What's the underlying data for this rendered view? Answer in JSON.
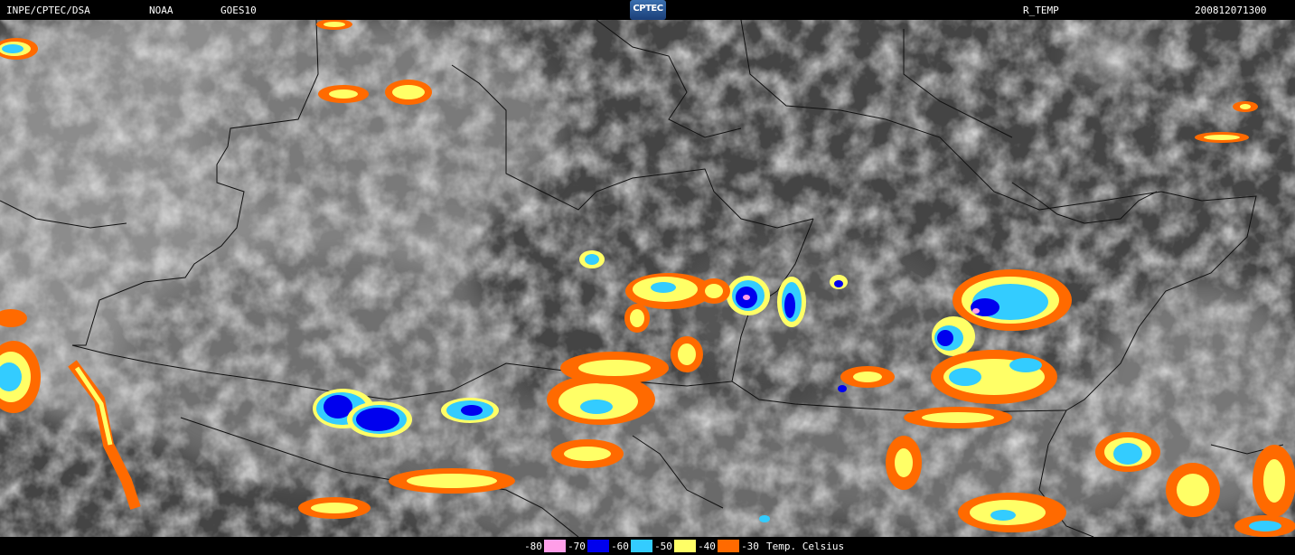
{
  "header": {
    "org": "INPE/CPTEC/DSA",
    "agency": "NOAA",
    "satellite": "GOES10",
    "logo_text": "CPTEC",
    "product": "R_TEMP",
    "timestamp": "200812071300"
  },
  "legend": {
    "unit_label": "Temp. Celsius",
    "items": [
      {
        "label": "-80",
        "color": "#ff9ee8"
      },
      {
        "label": "-70",
        "color": "#0000ee"
      },
      {
        "label": "-60",
        "color": "#33ccff"
      },
      {
        "label": "-50",
        "color": "#ffff66"
      },
      {
        "label": "-40",
        "color": "#ff6a00"
      },
      {
        "label": "-30",
        "color": ""
      }
    ]
  },
  "colors": {
    "background": "#000000",
    "land_dark": "#454545",
    "cloud_light": "#9a9a9a",
    "border_line": "#111111"
  }
}
